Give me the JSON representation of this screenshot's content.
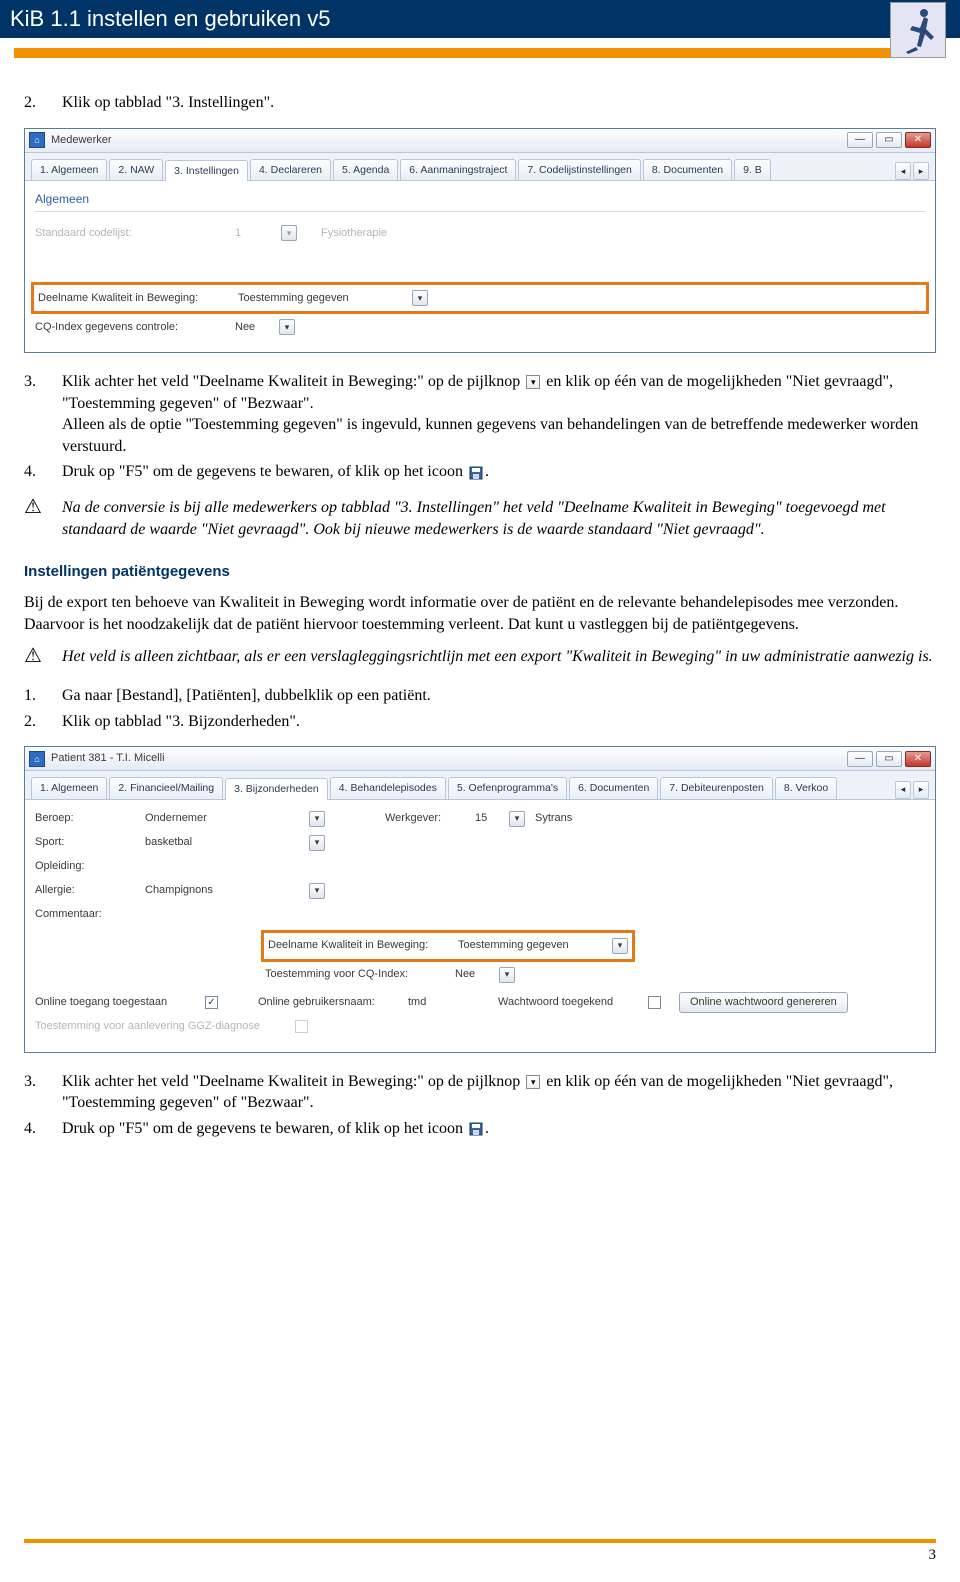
{
  "header": {
    "title": "KiB 1.1 instellen en gebruiken v5"
  },
  "steps_a": {
    "s2": "Klik op tabblad \"3. Instellingen\".",
    "s3a": "Klik achter het veld \"Deelname Kwaliteit in Beweging:\" op de pijlknop ",
    "s3b": " en klik op één van de mogelijkheden \"Niet gevraagd\", \"Toestemming gegeven\" of \"Bezwaar\".",
    "s3c": "Alleen als de optie \"Toestemming gegeven\" is ingevuld, kunnen gegevens van behandelingen van de betreffende medewerker worden verstuurd.",
    "s4a": "Druk op \"F5\" om de gegevens te bewaren, of klik op het icoon ",
    "s4b": "."
  },
  "note1": "Na de conversie is bij alle medewerkers op tabblad \"3. Instellingen\" het veld \"Deelname Kwaliteit in Beweging\" toegevoegd met standaard de waarde \"Niet gevraagd\". Ook bij nieuwe medewerkers is de waarde standaard \"Niet gevraagd\".",
  "section2": {
    "heading": "Instellingen patiëntgegevens",
    "body": "Bij de export ten behoeve van Kwaliteit in Beweging wordt informatie over de patiënt en de relevante behandelepisodes mee verzonden. Daarvoor is het noodzakelijk dat de patiënt hiervoor toestemming verleent. Dat kunt u vastleggen bij de patiëntgegevens."
  },
  "note2": "Het veld is alleen zichtbaar, als er een verslagleggingsrichtlijn met een export \"Kwaliteit in Beweging\" in uw administratie aanwezig is.",
  "steps_b": {
    "s1": "Ga naar [Bestand], [Patiënten], dubbelklik op een patiënt.",
    "s2": "Klik op tabblad \"3. Bijzonderheden\".",
    "s3a": "Klik achter het veld \"Deelname Kwaliteit in Beweging:\" op de pijlknop ",
    "s3b": " en klik op één van de mogelijkheden \"Niet gevraagd\", \"Toestemming gegeven\" of \"Bezwaar\".",
    "s4a": "Druk op \"F5\" om de gegevens te bewaren, of klik op het icoon ",
    "s4b": "."
  },
  "win1": {
    "title": "Medewerker",
    "tabs": [
      "1. Algemeen",
      "2. NAW",
      "3. Instellingen",
      "4. Declareren",
      "5. Agenda",
      "6. Aanmaningstraject",
      "7. Codelijstinstellingen",
      "8. Documenten",
      "9. B"
    ],
    "active_tab_index": 2,
    "group": "Algemeen",
    "row_dim_label": "Standaard codelijst:",
    "row_dim_val": "1",
    "row_dim_desc": "Fysiotherapie",
    "row1_label": "Deelname Kwaliteit in Beweging:",
    "row1_val": "Toestemming gegeven",
    "row2_label": "CQ-Index gegevens controle:",
    "row2_val": "Nee"
  },
  "win2": {
    "title": "Patient 381 - T.I. Micelli",
    "tabs": [
      "1. Algemeen",
      "2. Financieel/Mailing",
      "3. Bijzonderheden",
      "4. Behandelepisodes",
      "5. Oefenprogramma's",
      "6. Documenten",
      "7. Debiteurenposten",
      "8. Verkoo"
    ],
    "active_tab_index": 2,
    "labels": {
      "beroep": "Beroep:",
      "sport": "Sport:",
      "opleiding": "Opleiding:",
      "allergie": "Allergie:",
      "commentaar": "Commentaar:",
      "werkgever": "Werkgever:",
      "deelname": "Deelname Kwaliteit in Beweging:",
      "cq": "Toestemming voor CQ-Index:",
      "online_toegang": "Online toegang toegestaan",
      "online_user": "Online gebruikersnaam:",
      "wachtwoord": "Wachtwoord toegekend",
      "gen_btn": "Online wachtwoord genereren",
      "ggz": "Toestemming voor aanlevering GGZ-diagnose"
    },
    "values": {
      "beroep": "Ondernemer",
      "sport": "basketbal",
      "opleiding": "",
      "allergie": "Champignons",
      "werkgever_num": "15",
      "werkgever_name": "Sytrans",
      "deelname": "Toestemming gegeven",
      "cq": "Nee",
      "online_user": "tmd"
    }
  },
  "page_number": "3"
}
